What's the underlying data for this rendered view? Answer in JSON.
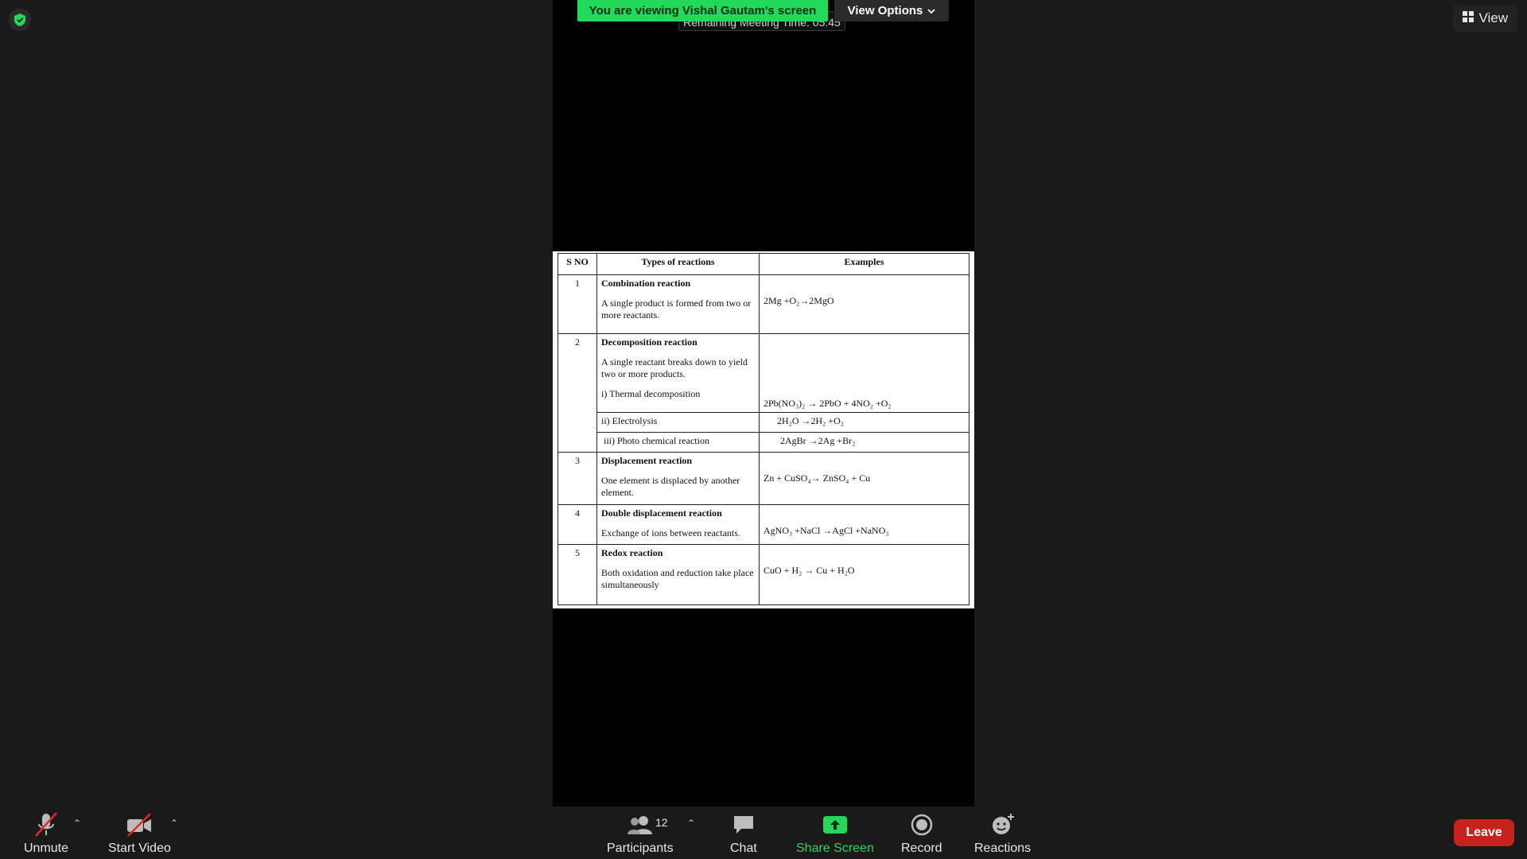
{
  "top": {
    "view_label": "View",
    "banner_text": "You are viewing Vishal Gautam's screen",
    "view_options_label": "View Options",
    "timer_text": "Remaining Meeting Time: 05:45"
  },
  "table": {
    "headers": [
      "S NO",
      "Types of reactions",
      "Examples"
    ],
    "rows": [
      {
        "sno": "1",
        "title": "Combination reaction",
        "desc": "A single product is formed from two or more reactants.",
        "example": "2Mg +O₂→2MgO"
      },
      {
        "sno": "2",
        "title": "Decomposition reaction",
        "desc": "A single reactant breaks down to yield two or more products.",
        "sub1": "i) Thermal decomposition",
        "example": "2Pb(NO₃)₂ → 2PbO + 4NO₂ +O₂",
        "sub2": "ii) Electrolysis",
        "example2": "2H₂O →2H₂ +O₂",
        "sub3": "iii) Photo chemical reaction",
        "example3": "2AgBr →2Ag +Br₂"
      },
      {
        "sno": "3",
        "title": "Displacement reaction",
        "desc": "One element is displaced by another element.",
        "example": "Zn + CuSO₄→ ZnSO₄ + Cu"
      },
      {
        "sno": "4",
        "title": "Double displacement reaction",
        "desc": "Exchange of ions between reactants.",
        "example": "AgNO₃ +NaCl →AgCl +NaNO₃"
      },
      {
        "sno": "5",
        "title": "Redox reaction",
        "desc": "Both oxidation and reduction take place simultaneously",
        "example": "CuO + H₂ → Cu + H₂O"
      }
    ]
  },
  "toolbar": {
    "unmute": "Unmute",
    "start_video": "Start Video",
    "participants": "Participants",
    "participant_count": "12",
    "chat": "Chat",
    "share_screen": "Share Screen",
    "record": "Record",
    "reactions": "Reactions",
    "leave": "Leave"
  },
  "colors": {
    "accent_green": "#23d959",
    "leave_red": "#c8221c",
    "background": "#1a1a1a"
  }
}
